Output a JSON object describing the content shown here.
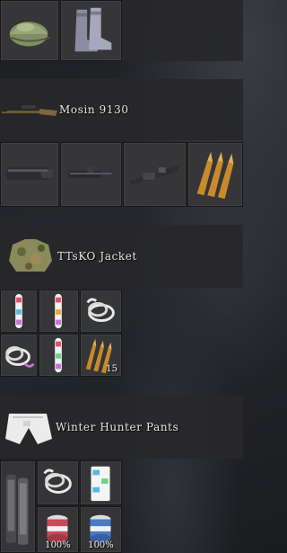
{
  "inventory": {
    "headgear_row": {
      "items": [
        {
          "icon": "helmet-icon"
        },
        {
          "icon": "boots-icon"
        }
      ]
    },
    "rifle": {
      "title": "Mosin 9130",
      "icon": "rifle-icon",
      "attachments": [
        {
          "icon": "suppressor-icon"
        },
        {
          "icon": "scope-icon"
        },
        {
          "icon": "bayonet-icon"
        },
        {
          "icon": "ammo-rounds-icon"
        }
      ]
    },
    "jacket": {
      "title": "TTsKO Jacket",
      "icon": "camo-jacket-icon",
      "items": [
        {
          "icon": "chemlight-icon"
        },
        {
          "icon": "chemlight-icon"
        },
        {
          "icon": "rope-icon"
        },
        {
          "icon": "rope-icon"
        },
        {
          "icon": "chemlight-icon"
        },
        {
          "icon": "ammo-rounds-icon",
          "quantity": "15"
        }
      ]
    },
    "pants": {
      "title": "Winter Hunter Pants",
      "icon": "pants-icon",
      "items": [
        {
          "icon": "magazine-stack-icon"
        },
        {
          "icon": "rope-icon"
        },
        {
          "icon": "medicine-box-icon"
        },
        {
          "icon": "food-can-icon",
          "quantity": "100%"
        },
        {
          "icon": "food-can-icon",
          "quantity": "100%"
        }
      ]
    }
  }
}
